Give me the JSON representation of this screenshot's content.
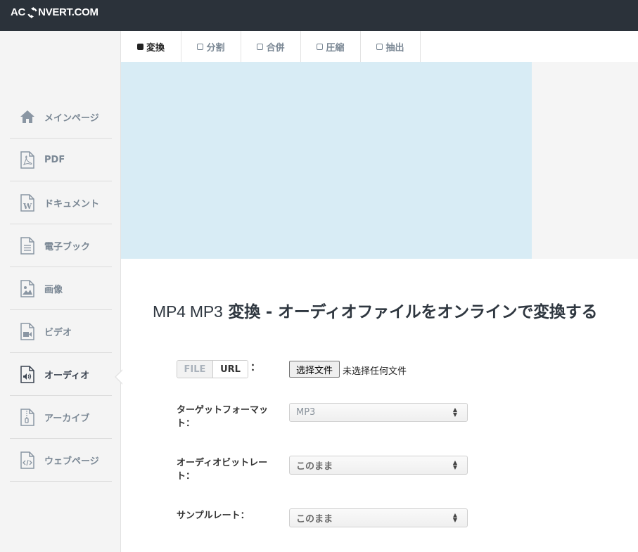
{
  "brand": {
    "logo_left": "AC",
    "logo_right": "NVERT.COM"
  },
  "tabs": [
    {
      "label": "変換"
    },
    {
      "label": "分割"
    },
    {
      "label": "合併"
    },
    {
      "label": "圧縮"
    },
    {
      "label": "抽出"
    }
  ],
  "sidebar": {
    "items": [
      {
        "label": "メインページ",
        "icon": "home-icon"
      },
      {
        "label": "PDF",
        "icon": "pdf-file-icon"
      },
      {
        "label": "ドキュメント",
        "icon": "word-document-icon"
      },
      {
        "label": "電子ブック",
        "icon": "ebook-icon"
      },
      {
        "label": "画像",
        "icon": "image-file-icon"
      },
      {
        "label": "ビデオ",
        "icon": "video-file-icon"
      },
      {
        "label": "オーディオ",
        "icon": "audio-file-icon",
        "active": true
      },
      {
        "label": "アーカイブ",
        "icon": "archive-file-icon"
      },
      {
        "label": "ウェブページ",
        "icon": "code-file-icon"
      }
    ]
  },
  "page": {
    "title_prefix": "MP4 MP3",
    "title_main": "変換 - オーディオファイルをオンラインで変換する"
  },
  "form": {
    "source_toggle": {
      "file": "FILE",
      "url": "URL",
      "colon": "："
    },
    "file_input": {
      "button": "选择文件",
      "status": "未选择任何文件"
    },
    "target_format": {
      "label": "ターゲットフォーマット：",
      "value": "MP3"
    },
    "audio_bitrate": {
      "label": "オーディオビットレート：",
      "value": "このまま"
    },
    "sample_rate": {
      "label": "サンプルレート：",
      "value": "このまま"
    }
  },
  "colors": {
    "topbar": "#2b323a",
    "ad": "#d8ecf5",
    "sidebar": "#f4f4f4"
  }
}
